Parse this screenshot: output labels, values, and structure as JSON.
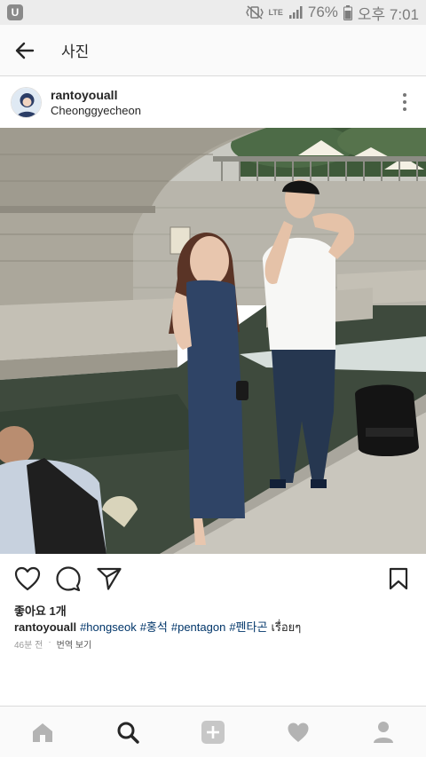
{
  "status_bar": {
    "lte": "LTE",
    "battery": "76%",
    "time": "오후 7:01"
  },
  "toolbar": {
    "title": "사진"
  },
  "post": {
    "username": "rantoyouall",
    "location": "Cheonggyecheon",
    "likes": "좋아요 1개",
    "caption_user": "rantoyouall",
    "hashtags": [
      "#hongseok",
      "#홍석",
      "#pentagon",
      "#펜타곤"
    ],
    "caption_tail": "เรื่อยๆ",
    "time_ago": "46분 전",
    "translate_label": "번역 보기"
  },
  "icons": {
    "back": "arrow-left-icon",
    "more": "more-vertical-icon",
    "like": "heart-outline-icon",
    "comment": "comment-icon",
    "share": "send-icon",
    "save": "bookmark-icon",
    "nav": [
      "home-icon",
      "search-icon",
      "add-icon",
      "activity-heart-icon",
      "profile-icon"
    ]
  },
  "colors": {
    "link": "#003569",
    "active_nav": "#262626",
    "inactive_nav": "#b3b3b3"
  }
}
